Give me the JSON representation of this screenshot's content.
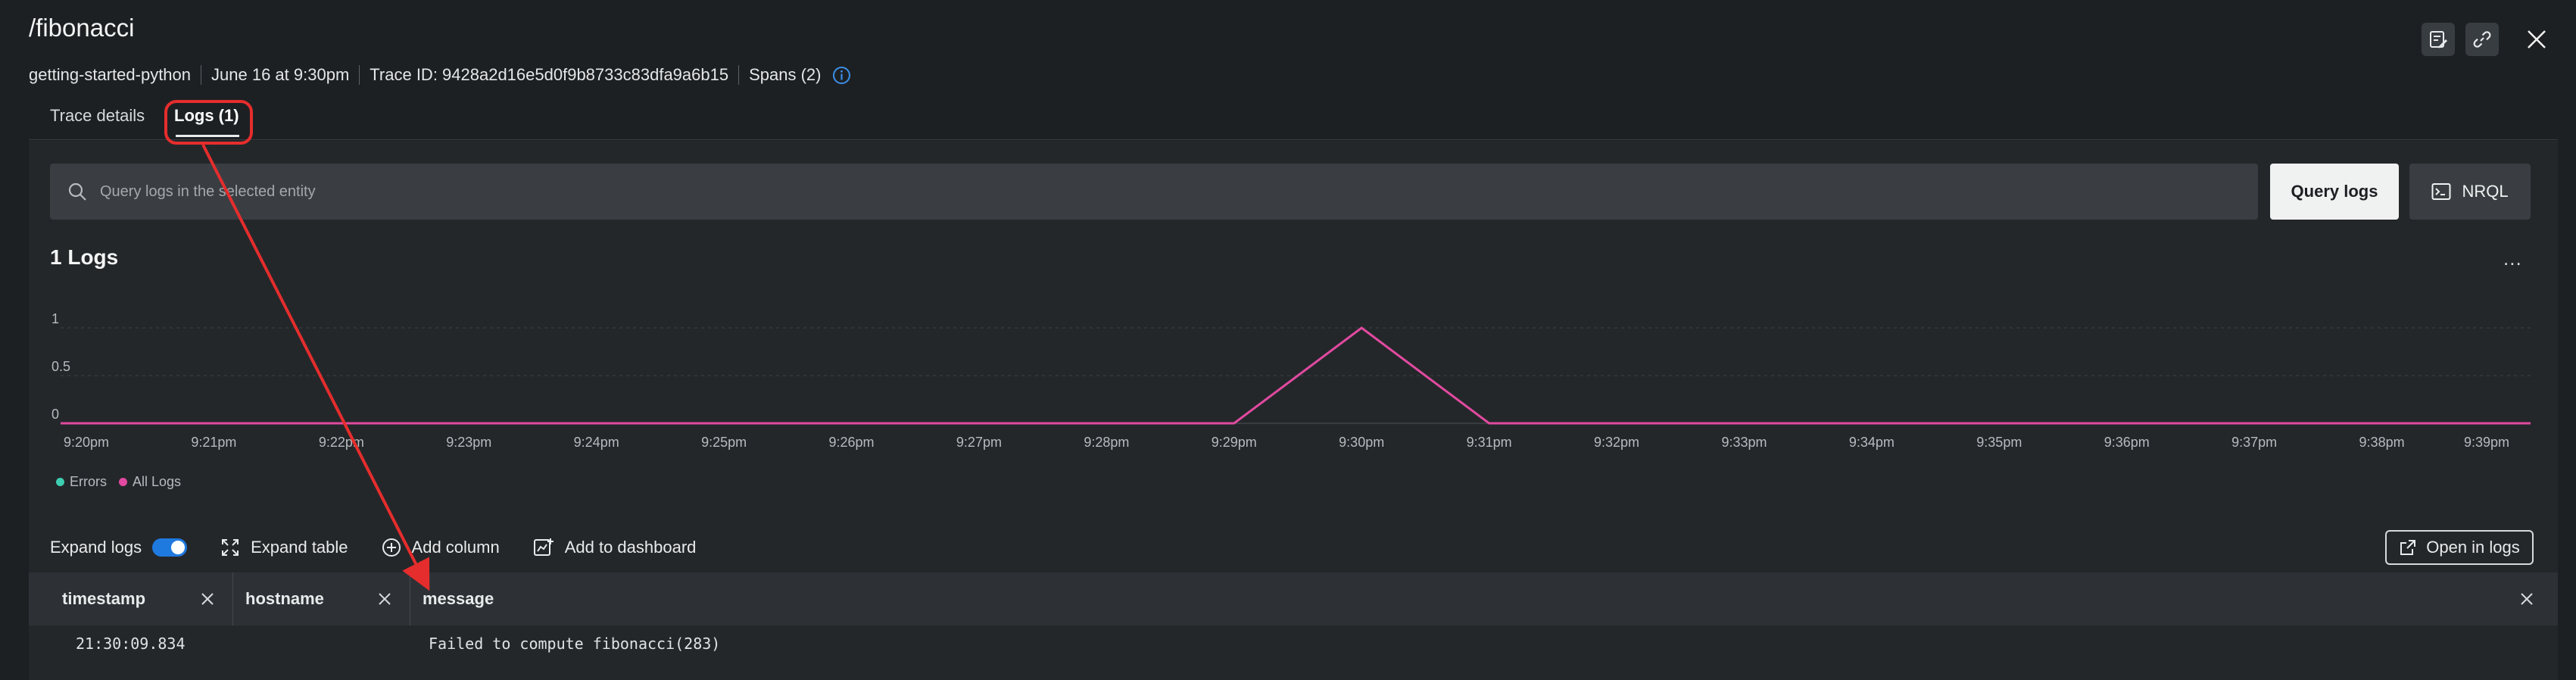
{
  "header": {
    "title": "/fibonacci",
    "meta": {
      "entity": "getting-started-python",
      "date": "June 16 at 9:30pm",
      "trace_id": "Trace ID: 9428a2d16e5d0f9b8733c83dfa9a6b15",
      "spans": "Spans (2)"
    }
  },
  "tabs": [
    {
      "label": "Trace details"
    },
    {
      "label": "Logs (1)"
    }
  ],
  "search": {
    "placeholder": "Query logs in the selected entity"
  },
  "buttons": {
    "query_logs": "Query logs",
    "nrql": "NRQL",
    "open_in_logs": "Open in logs"
  },
  "logs_panel": {
    "title": "1 Logs",
    "more": "..."
  },
  "legend": [
    {
      "label": "Errors",
      "color": "#3ecfb2"
    },
    {
      "label": "All Logs",
      "color": "#e14aa0"
    }
  ],
  "toolbar": {
    "expand_logs": "Expand logs",
    "expand_table": "Expand table",
    "add_column": "Add column",
    "add_to_dashboard": "Add to dashboard"
  },
  "table": {
    "columns": [
      "timestamp",
      "hostname",
      "message"
    ],
    "rows": [
      {
        "timestamp": "21:30:09.834",
        "hostname": "",
        "message": "Failed to compute fibonacci(283)"
      }
    ]
  },
  "chart_data": {
    "type": "line",
    "x": [
      "9:20pm",
      "9:21pm",
      "9:22pm",
      "9:23pm",
      "9:24pm",
      "9:25pm",
      "9:26pm",
      "9:27pm",
      "9:28pm",
      "9:29pm",
      "9:30pm",
      "9:31pm",
      "9:32pm",
      "9:33pm",
      "9:34pm",
      "9:35pm",
      "9:36pm",
      "9:37pm",
      "9:38pm",
      "9:39pm"
    ],
    "series": [
      {
        "name": "All Logs",
        "color": "#e14aa0",
        "values": [
          0,
          0,
          0,
          0,
          0,
          0,
          0,
          0,
          0,
          0,
          1,
          0,
          0,
          0,
          0,
          0,
          0,
          0,
          0,
          0
        ]
      }
    ],
    "yticks": [
      "1",
      "0.5",
      "0"
    ],
    "ylim": [
      0,
      1
    ],
    "grid": true,
    "legend_position": "bottom-left"
  }
}
